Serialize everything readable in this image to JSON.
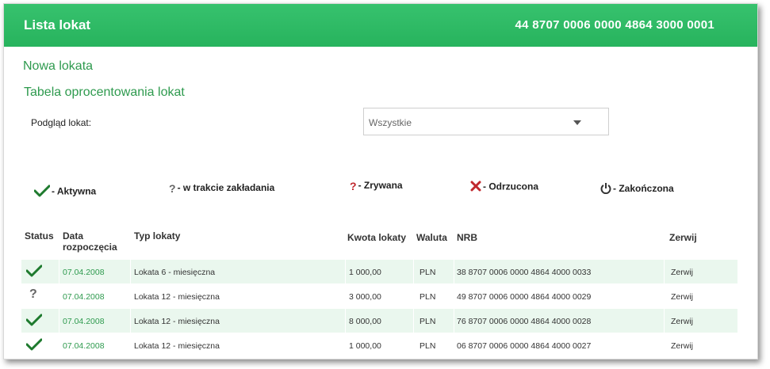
{
  "header": {
    "title": "Lista lokat",
    "account": "44 8707 0006 0000 4864 3000 0001"
  },
  "links": {
    "new_deposit": "Nowa lokata",
    "rates_table": "Tabela oprocentowania lokat"
  },
  "filter": {
    "label": "Podgląd lokat:",
    "selected": "Wszystkie"
  },
  "legend": [
    {
      "icon": "check-icon",
      "label": "- Aktywna"
    },
    {
      "icon": "question-gray-icon",
      "label": "- w trakcie zakładania"
    },
    {
      "icon": "question-red-icon",
      "label": "- Zrywana"
    },
    {
      "icon": "x-icon",
      "label": "- Odrzucona"
    },
    {
      "icon": "power-icon",
      "label": "- Zakończona"
    }
  ],
  "table": {
    "headers": {
      "status": "Status",
      "date_line1": "Data",
      "date_line2": "rozpoczęcia",
      "type": "Typ lokaty",
      "amount": "Kwota lokaty",
      "currency": "Waluta",
      "nrb": "NRB",
      "action": "Zerwij"
    },
    "rows": [
      {
        "status": "active",
        "date": "07.04.2008",
        "type": "Lokata 6 - miesięczna",
        "amount": "1 000,00",
        "currency": "PLN",
        "nrb": "38 8707 0006 0000 4864 4000 0033",
        "action": "Zerwij"
      },
      {
        "status": "pending",
        "date": "07.04.2008",
        "type": "Lokata 12 - miesięczna",
        "amount": "3 000,00",
        "currency": "PLN",
        "nrb": "49 8707 0006 0000 4864 4000 0029",
        "action": "Zerwij"
      },
      {
        "status": "active",
        "date": "07.04.2008",
        "type": "Lokata 12 - miesięczna",
        "amount": "8 000,00",
        "currency": "PLN",
        "nrb": "76 8707 0006 0000 4864 4000 0028",
        "action": "Zerwij"
      },
      {
        "status": "active",
        "date": "07.04.2008",
        "type": "Lokata 12 - miesięczna",
        "amount": "1 000,00",
        "currency": "PLN",
        "nrb": "06 8707 0006 0000 4864 4000 0027",
        "action": "Zerwij"
      }
    ]
  },
  "colors": {
    "header": "#2fb964",
    "accent": "#2e9a4e",
    "row_alt": "#eaf7ee",
    "check": "#1e7a2e",
    "cancel": "#c0282d"
  }
}
